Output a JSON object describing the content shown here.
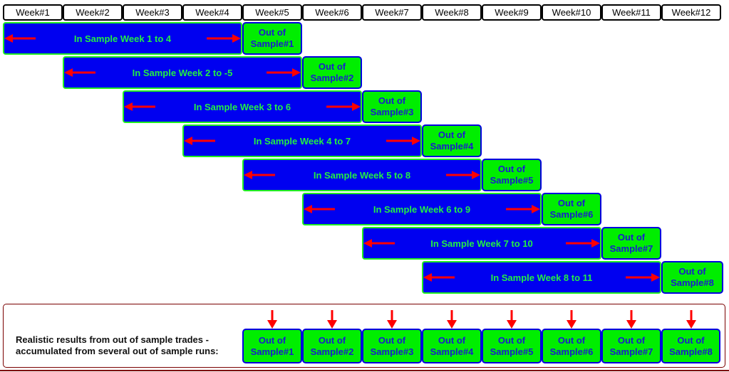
{
  "weeks": [
    "Week#1",
    "Week#2",
    "Week#3",
    "Week#4",
    "Week#5",
    "Week#6",
    "Week#7",
    "Week#8",
    "Week#9",
    "Week#10",
    "Week#11",
    "Week#12"
  ],
  "rows": [
    {
      "in_sample": "In Sample Week 1 to 4",
      "oos_line1": "Out of",
      "oos_line2": "Sample#1"
    },
    {
      "in_sample": "In Sample Week 2 to -5",
      "oos_line1": "Out of",
      "oos_line2": "Sample#2"
    },
    {
      "in_sample": "In Sample Week 3 to 6",
      "oos_line1": "Out of",
      "oos_line2": "Sample#3"
    },
    {
      "in_sample": "In Sample Week 4 to 7",
      "oos_line1": "Out of",
      "oos_line2": "Sample#4"
    },
    {
      "in_sample": "In Sample Week 5 to 8",
      "oos_line1": "Out of",
      "oos_line2": "Sample#5"
    },
    {
      "in_sample": "In Sample Week 6 to 9",
      "oos_line1": "Out of",
      "oos_line2": "Sample#6"
    },
    {
      "in_sample": "In Sample Week 7 to 10",
      "oos_line1": "Out of",
      "oos_line2": "Sample#7"
    },
    {
      "in_sample": "In Sample Week 8 to 11",
      "oos_line1": "Out of",
      "oos_line2": "Sample#8"
    }
  ],
  "summary": {
    "line1": "Realistic results from out of sample trades -",
    "line2": "accumulated from several out of sample runs:",
    "boxes": [
      {
        "line1": "Out of",
        "line2": "Sample#1"
      },
      {
        "line1": "Out of",
        "line2": "Sample#2"
      },
      {
        "line1": "Out of",
        "line2": "Sample#3"
      },
      {
        "line1": "Out of",
        "line2": "Sample#4"
      },
      {
        "line1": "Out of",
        "line2": "Sample#5"
      },
      {
        "line1": "Out of",
        "line2": "Sample#6"
      },
      {
        "line1": "Out of",
        "line2": "Sample#7"
      },
      {
        "line1": "Out of",
        "line2": "Sample#8"
      }
    ]
  },
  "colors": {
    "in_sample_fill": "#0000f0",
    "in_sample_text": "#22ee44",
    "out_of_sample_fill": "#00ee00",
    "out_of_sample_text": "#1a1ad0",
    "arrow": "#ff0000",
    "panel_border": "#7a0000"
  }
}
